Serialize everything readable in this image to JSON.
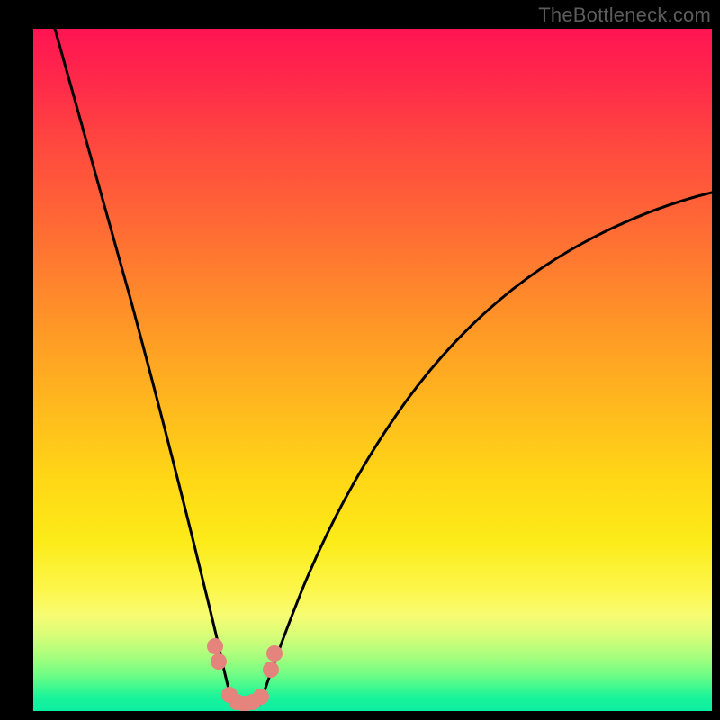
{
  "watermark": "TheBottleneck.com",
  "chart_data": {
    "type": "line",
    "title": "",
    "xlabel": "",
    "ylabel": "",
    "xlim": [
      0,
      100
    ],
    "ylim": [
      0,
      100
    ],
    "gradient_stops": [
      {
        "pos": 0,
        "color": "#ff1452"
      },
      {
        "pos": 8,
        "color": "#ff2a4a"
      },
      {
        "pos": 18,
        "color": "#ff4b3e"
      },
      {
        "pos": 30,
        "color": "#ff6d34"
      },
      {
        "pos": 42,
        "color": "#ff9228"
      },
      {
        "pos": 55,
        "color": "#ffb81e"
      },
      {
        "pos": 66,
        "color": "#ffd716"
      },
      {
        "pos": 75,
        "color": "#fceb18"
      },
      {
        "pos": 82,
        "color": "#fdf64a"
      },
      {
        "pos": 86,
        "color": "#f7fd72"
      },
      {
        "pos": 89,
        "color": "#d7fd78"
      },
      {
        "pos": 92,
        "color": "#a7fe7d"
      },
      {
        "pos": 94.5,
        "color": "#74fd85"
      },
      {
        "pos": 96.5,
        "color": "#40f98f"
      },
      {
        "pos": 98,
        "color": "#19f39a"
      },
      {
        "pos": 100,
        "color": "#0beea3"
      }
    ],
    "series": [
      {
        "name": "left-branch",
        "x": [
          3.2,
          6.0,
          9.0,
          12.0,
          15.0,
          18.0,
          21.0,
          23.5,
          25.5,
          27.0,
          28.5
        ],
        "y": [
          100,
          90,
          79,
          68,
          56,
          44,
          32,
          21,
          12,
          6,
          1.5
        ]
      },
      {
        "name": "right-branch",
        "x": [
          34.0,
          36.0,
          39.0,
          43.0,
          48.0,
          54.0,
          61.0,
          69.0,
          78.0,
          88.0,
          100.0
        ],
        "y": [
          1.5,
          6,
          13,
          22,
          31,
          40,
          48,
          55,
          62,
          68,
          74
        ]
      }
    ],
    "markers": {
      "name": "salmon-dots",
      "color": "#e4847c",
      "points": [
        {
          "x": 26.8,
          "y": 9.5
        },
        {
          "x": 27.3,
          "y": 7.2
        },
        {
          "x": 28.9,
          "y": 2.3
        },
        {
          "x": 30.0,
          "y": 1.3
        },
        {
          "x": 31.2,
          "y": 1.1
        },
        {
          "x": 32.4,
          "y": 1.3
        },
        {
          "x": 33.5,
          "y": 2.1
        },
        {
          "x": 35.0,
          "y": 6.0
        },
        {
          "x": 35.6,
          "y": 8.4
        }
      ]
    }
  }
}
